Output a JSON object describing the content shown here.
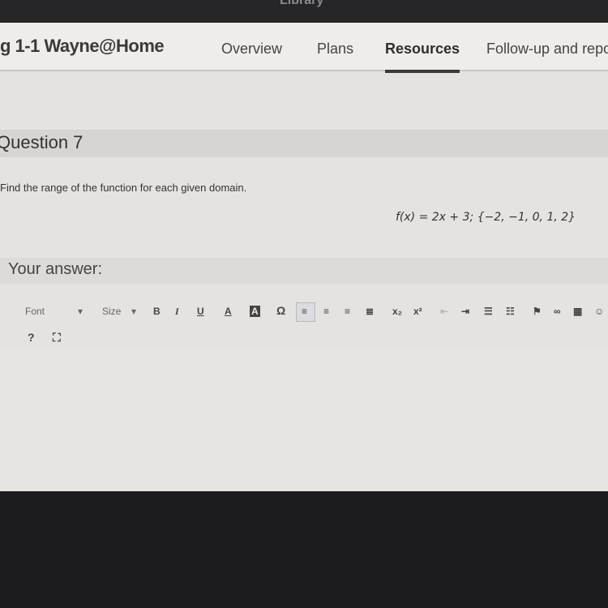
{
  "topnav": {
    "partial_item": "Library"
  },
  "header": {
    "title": "g 1-1 Wayne@Home",
    "tabs": [
      {
        "label": "Overview"
      },
      {
        "label": "Plans"
      },
      {
        "label": "Resources",
        "active": true
      },
      {
        "label": "Follow-up and repo"
      }
    ]
  },
  "question": {
    "title": "Question 7",
    "prompt": "Find the range of the function for each given domain.",
    "formula": "f(x) = 2x + 3; {−2, −1, 0, 1, 2}"
  },
  "answer": {
    "label": "Your answer:"
  },
  "toolbar": {
    "font": "Font",
    "size": "Size",
    "bold": "B",
    "italic": "I",
    "underline": "U",
    "text_color": "A",
    "bg_color": "A",
    "special_char": "Ω",
    "subscript": "x₂",
    "superscript": "x²",
    "help": "?",
    "maximize": "⛶",
    "dropdown": "▾"
  },
  "icons": [
    "align-left-icon",
    "align-center-icon",
    "align-right-icon",
    "justify-icon",
    "outdent-icon",
    "indent-icon",
    "numbered-list-icon",
    "bullet-list-icon",
    "flag-icon",
    "link-icon",
    "table-icon",
    "smiley-icon"
  ]
}
